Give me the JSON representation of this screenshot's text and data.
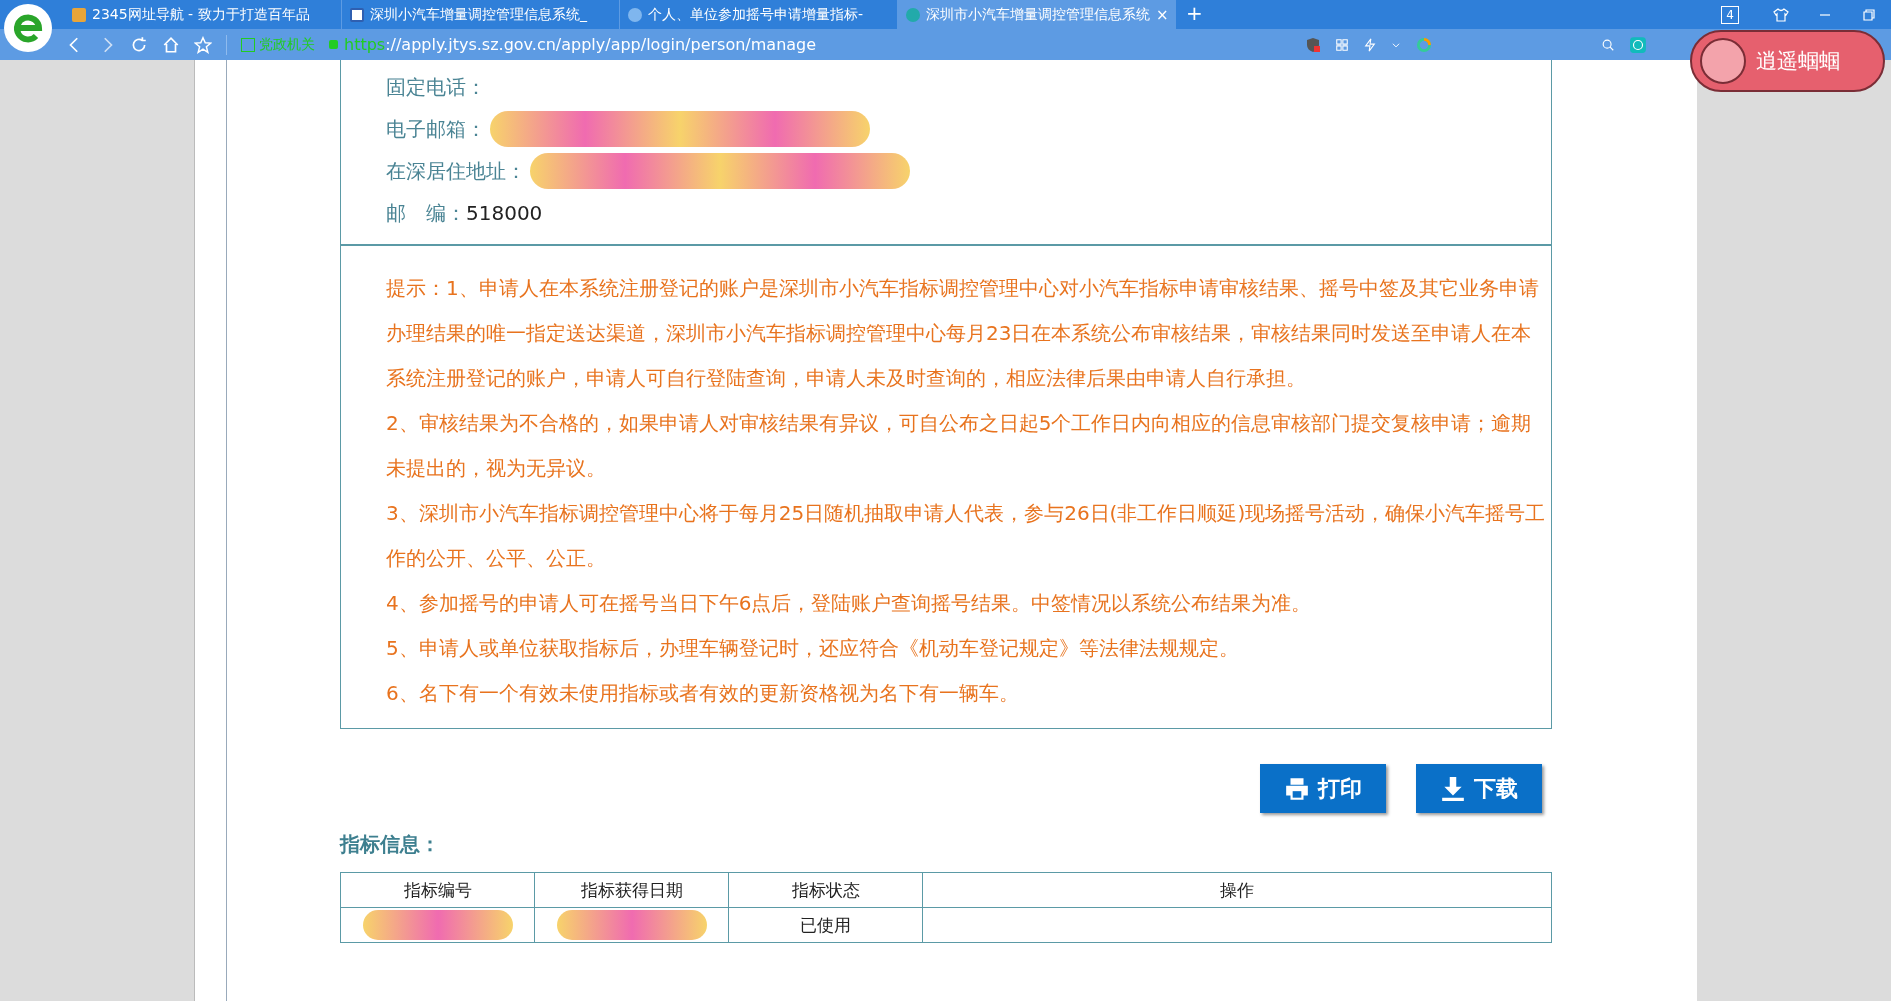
{
  "browser": {
    "tabs": [
      {
        "title": "2345网址导航 - 致力于打造百年品",
        "selected": false
      },
      {
        "title": "深圳小汽车增量调控管理信息系统_",
        "selected": false
      },
      {
        "title": "个人、单位参加摇号申请增量指标-",
        "selected": false
      },
      {
        "title": "深圳市小汽车增量调控管理信息系统",
        "selected": true
      }
    ],
    "new_tab": "+",
    "close_tab": "×",
    "tab_count": "4",
    "security_label": "党政机关",
    "url_scheme": "https",
    "url_rest": "://apply.jtys.sz.gov.cn/apply/app/login/person/manage",
    "sticker_text": "逍遥蝈蝈"
  },
  "contact": [
    {
      "label": "固定电话：",
      "redacted": false
    },
    {
      "label": "电子邮箱：",
      "redacted": true
    },
    {
      "label": "在深居住地址：",
      "redacted": true
    },
    {
      "label": "邮　编：",
      "value": "518000",
      "redacted": false
    }
  ],
  "notes": [
    "提示：1、申请人在本系统注册登记的账户是深圳市小汽车指标调控管理中心对小汽车指标申请审核结果、摇号中签及其它业务申请办理结果的唯一指定送达渠道，深圳市小汽车指标调控管理中心每月23日在本系统公布审核结果，审核结果同时发送至申请人在本系统注册登记的账户，申请人可自行登陆查询，申请人未及时查询的，相应法律后果由申请人自行承担。",
    "2、审核结果为不合格的，如果申请人对审核结果有异议，可自公布之日起5个工作日内向相应的信息审核部门提交复核申请；逾期未提出的，视为无异议。",
    "3、深圳市小汽车指标调控管理中心将于每月25日随机抽取申请人代表，参与26日(非工作日顺延)现场摇号活动，确保小汽车摇号工作的公开、公平、公正。",
    "4、参加摇号的申请人可在摇号当日下午6点后，登陆账户查询摇号结果。中签情况以系统公布结果为准。",
    "5、申请人或单位获取指标后，办理车辆登记时，还应符合《机动车登记规定》等法律法规规定。",
    "6、名下有一个有效未使用指标或者有效的更新资格视为名下有一辆车。"
  ],
  "buttons": [
    {
      "label": "打印",
      "kind": "print"
    },
    {
      "label": "下载",
      "kind": "download"
    }
  ],
  "quota": {
    "title": "指标信息：",
    "columns": [
      "指标编号",
      "指标获得日期",
      "指标状态",
      "操作"
    ],
    "rows": [
      {
        "number_redacted": true,
        "date_redacted": true,
        "status": "已使用"
      }
    ]
  }
}
